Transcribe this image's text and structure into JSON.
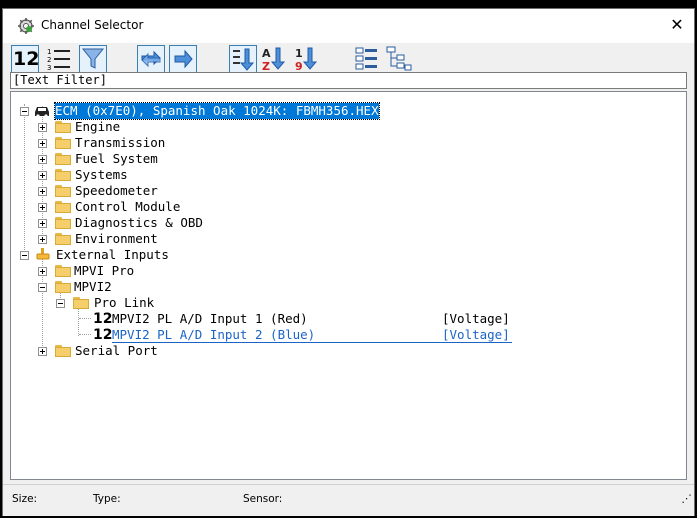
{
  "window": {
    "title": "Channel Selector",
    "close_label": "✕"
  },
  "toolbar": {
    "buttons": [
      "numeric-view",
      "list-view",
      "filter",
      "back",
      "forward",
      "sort-default",
      "sort-alpha",
      "sort-numeric",
      "expand-all",
      "collapse-all"
    ],
    "sort_alpha_a": "A",
    "sort_alpha_z": "Z",
    "sort_num_1": "1",
    "sort_num_9": "9",
    "numeric_label": "12"
  },
  "filter": {
    "text": "[Text Filter]"
  },
  "tree": {
    "root": "ECM (0x7E0), Spanish Oak 1024K: FBMH356.HEX",
    "groups": [
      "Engine",
      "Transmission",
      "Fuel System",
      "Systems",
      "Speedometer",
      "Control Module",
      "Diagnostics & OBD",
      "Environment"
    ],
    "external": "External Inputs",
    "mpvi_pro": "MPVI Pro",
    "mpvi2": "MPVI2",
    "pro_link": "Pro Link",
    "channels": [
      {
        "icon": "12",
        "name": "MPVI2 PL A/D Input 1 (Red)",
        "type": "[Voltage]"
      },
      {
        "icon": "12",
        "name": "MPVI2 PL A/D Input 2 (Blue)",
        "type": "[Voltage]"
      }
    ],
    "serial": "Serial Port"
  },
  "status": {
    "size_label": "Size:",
    "type_label": "Type:",
    "sensor_label": "Sensor:",
    "grip": "⋰"
  },
  "colors": {
    "selection": "#0078d7",
    "link_blue": "#1a64c8",
    "toolbar_accent": "#3c7fb1"
  }
}
